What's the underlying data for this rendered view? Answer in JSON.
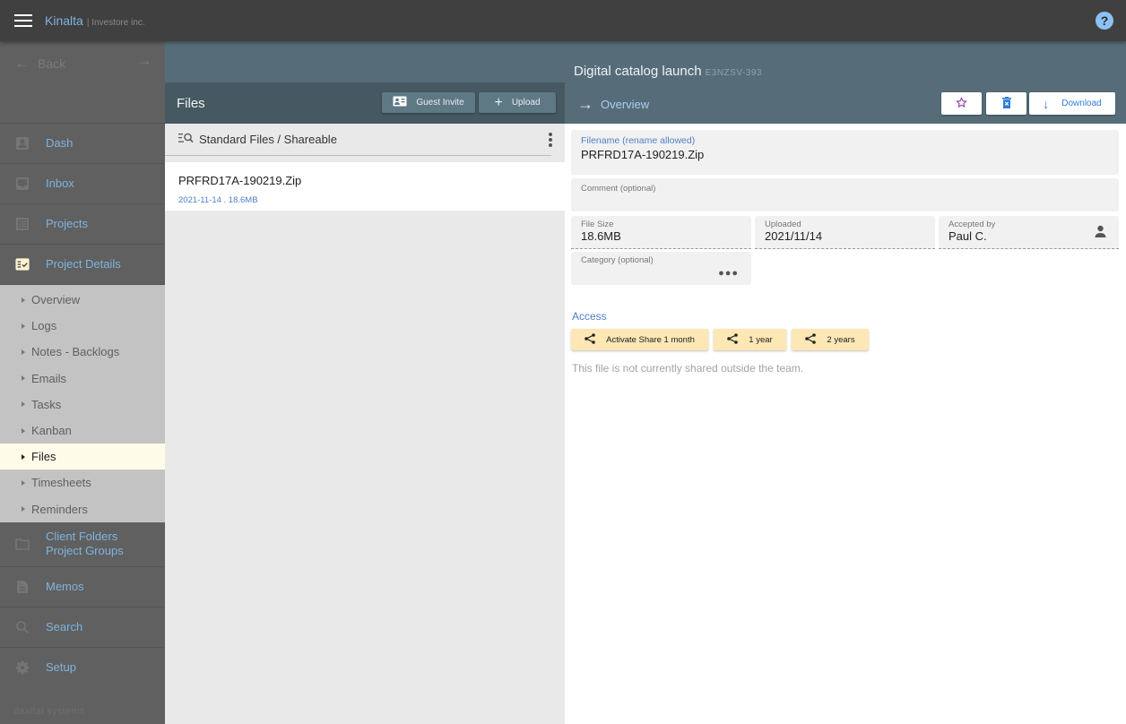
{
  "app": {
    "name": "Kinalta",
    "company": "| Investore inc.",
    "help_icon": "?"
  },
  "sidebar": {
    "back_label": "Back",
    "items": [
      {
        "label": "Dash",
        "icon": "person-icon"
      },
      {
        "label": "Inbox",
        "icon": "inbox-icon"
      },
      {
        "label": "Projects",
        "icon": "list-icon"
      },
      {
        "label": "Project Details",
        "icon": "checklist-icon"
      }
    ],
    "sub_items": [
      {
        "label": "Overview",
        "active": false
      },
      {
        "label": "Logs",
        "active": false
      },
      {
        "label": "Notes - Backlogs",
        "active": false
      },
      {
        "label": "Emails",
        "active": false
      },
      {
        "label": "Tasks",
        "active": false
      },
      {
        "label": "Kanban",
        "active": false
      },
      {
        "label": "Files",
        "active": true
      },
      {
        "label": "Timesheets",
        "active": false
      },
      {
        "label": "Reminders",
        "active": false
      }
    ],
    "bottom_items": [
      {
        "label_line1": "Client Folders",
        "label_line2": "Project Groups",
        "icon": "folder-icon"
      },
      {
        "label": "Memos",
        "icon": "document-icon"
      },
      {
        "label": "Search",
        "icon": "search-icon"
      },
      {
        "label": "Setup",
        "icon": "gear-icon"
      }
    ],
    "footer": "daxital systems"
  },
  "header": {
    "project_title": "Digital catalog launch",
    "project_code": "E3NZSV-393",
    "files_title": "Files",
    "guest_invite_label": "Guest Invite",
    "upload_label": "Upload",
    "overview_label": "Overview",
    "download_label": "Download"
  },
  "files": {
    "filter_label": "Standard Files / Shareable",
    "list": [
      {
        "name": "PRFRD17A-190219.Zip",
        "meta": "2021-11-14 . 18.6MB"
      }
    ]
  },
  "detail": {
    "filename_label": "Filename (rename allowed)",
    "filename_value": "PRFRD17A-190219.Zip",
    "comment_label": "Comment (optional)",
    "comment_value": "",
    "filesize_label": "File Size",
    "filesize_value": "18.6MB",
    "uploaded_label": "Uploaded",
    "uploaded_value": "2021/11/14",
    "accepted_label": "Accepted by",
    "accepted_value": "Paul C.",
    "category_label": "Category (optional)",
    "category_value": "",
    "access_title": "Access",
    "share_buttons": [
      "Activate Share 1 month",
      "1 year",
      "2 years"
    ],
    "share_note": "This file is not currently shared outside the team."
  },
  "colors": {
    "accent_blue": "#7eb3df",
    "header_slate": "#566d79",
    "share_button": "#fde7b5",
    "active_item": "#fefbe8"
  }
}
